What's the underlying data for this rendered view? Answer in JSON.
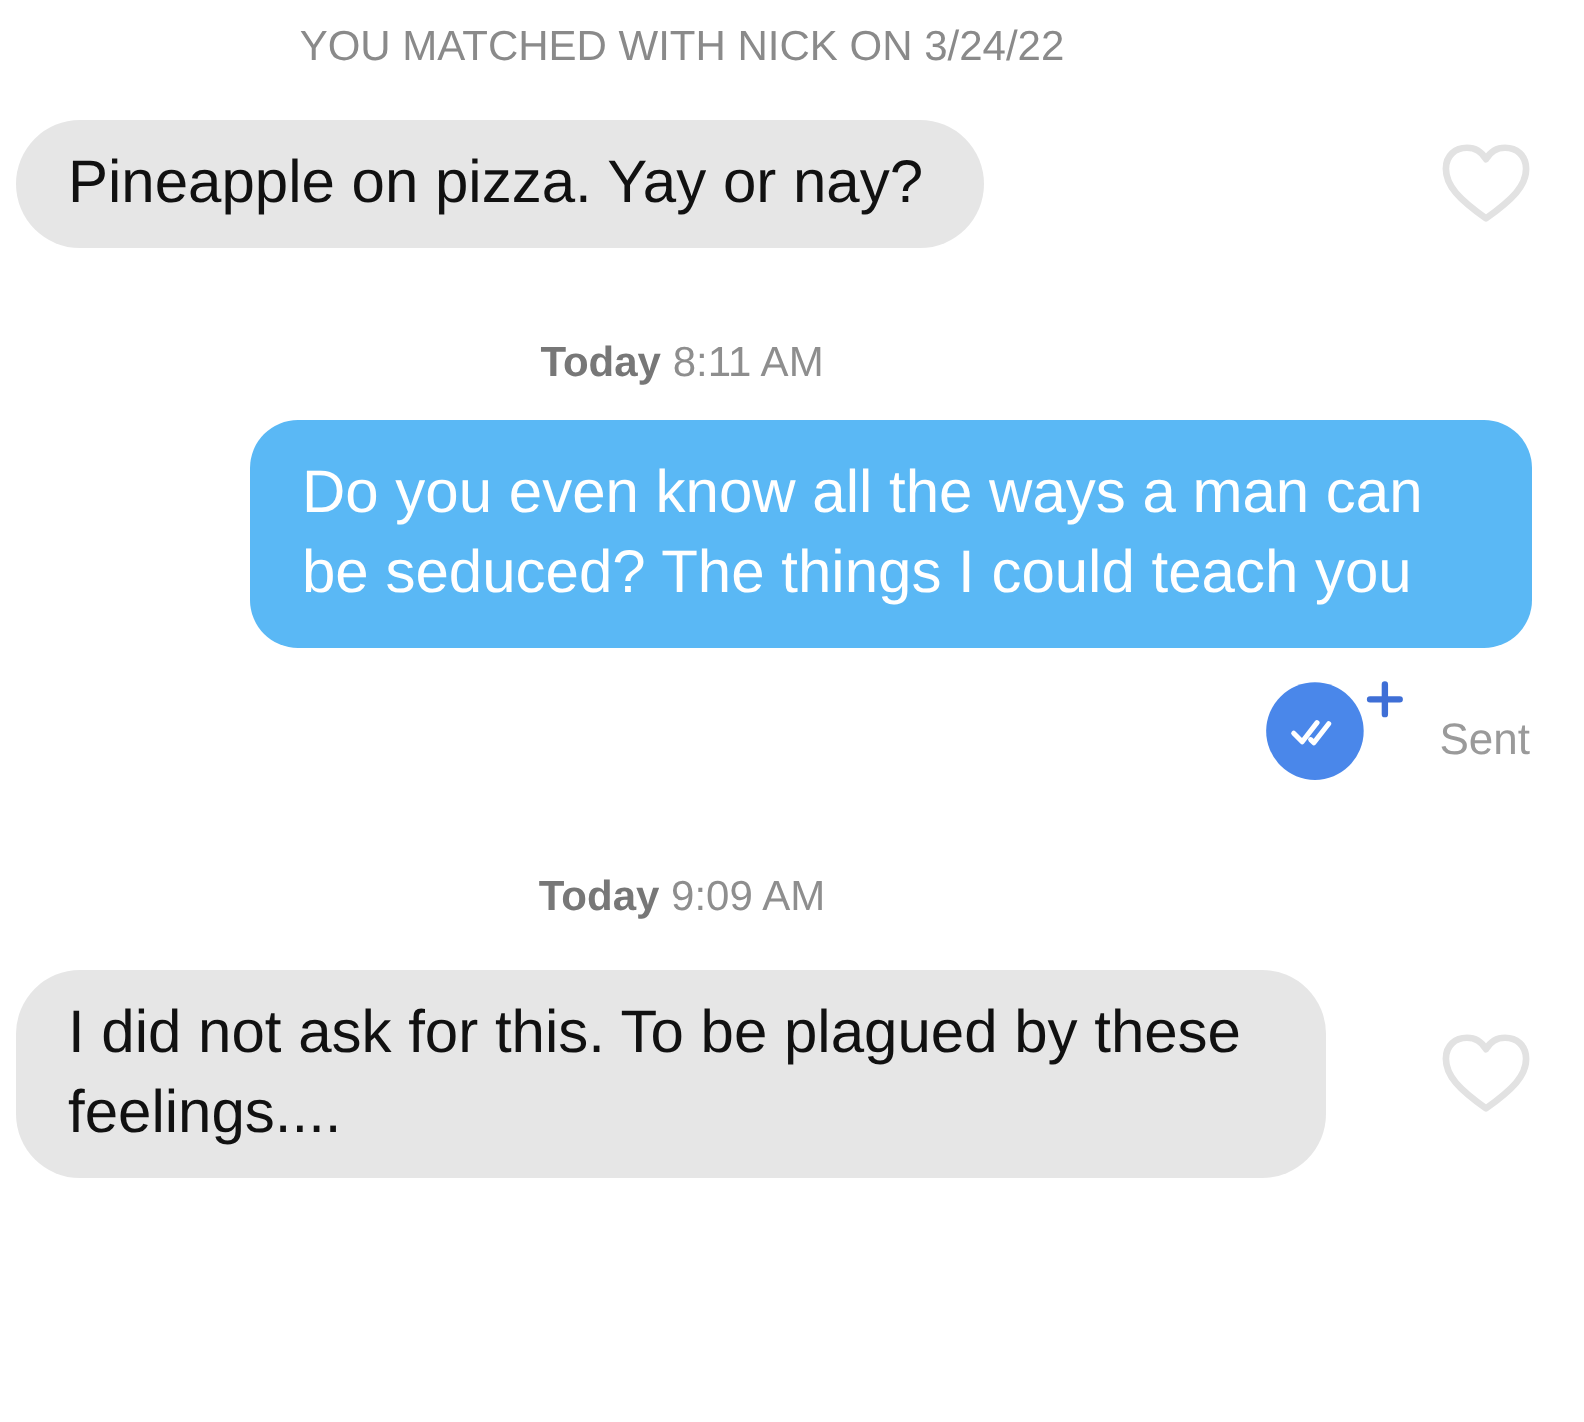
{
  "items": [
    {
      "kind": "notice",
      "text": "YOU MATCHED WITH NICK ON 3/24/22"
    },
    {
      "kind": "received",
      "text": "Pineapple on pizza. Yay or nay?",
      "liked": false
    },
    {
      "kind": "timestamp",
      "text": "**Today** 8:11 AM"
    },
    {
      "kind": "sent",
      "text": "Do you even know all the ways a man can be seduced? The things I could teach you"
    },
    {
      "kind": "status",
      "text": "Sent",
      "read": false
    },
    {
      "kind": "timestamp",
      "text": "**Today** 9:09 AM"
    },
    {
      "kind": "received",
      "text": "I did not ask for this. To be plagued by these feelings....",
      "liked": false
    }
  ]
}
